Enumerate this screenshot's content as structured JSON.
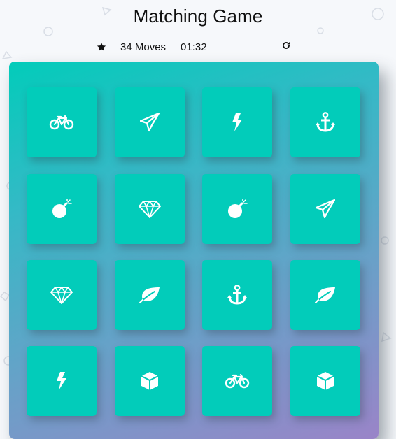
{
  "header": {
    "title": "Matching Game"
  },
  "score_panel": {
    "stars_icon": "star-icon",
    "moves_value": "34",
    "moves_label": "Moves",
    "timer": "01:32",
    "restart_icon": "restart-icon"
  },
  "colors": {
    "card": "#02ccba",
    "deck_gradient_start": "#02ccba",
    "deck_gradient_end": "#9a84c8",
    "icon": "#ffffff"
  },
  "deck": {
    "cards": [
      {
        "icon": "bicycle"
      },
      {
        "icon": "paper-plane"
      },
      {
        "icon": "bolt"
      },
      {
        "icon": "anchor"
      },
      {
        "icon": "bomb"
      },
      {
        "icon": "diamond"
      },
      {
        "icon": "bomb"
      },
      {
        "icon": "paper-plane"
      },
      {
        "icon": "diamond"
      },
      {
        "icon": "leaf"
      },
      {
        "icon": "anchor"
      },
      {
        "icon": "leaf"
      },
      {
        "icon": "bolt"
      },
      {
        "icon": "cube"
      },
      {
        "icon": "bicycle"
      },
      {
        "icon": "cube"
      }
    ]
  }
}
